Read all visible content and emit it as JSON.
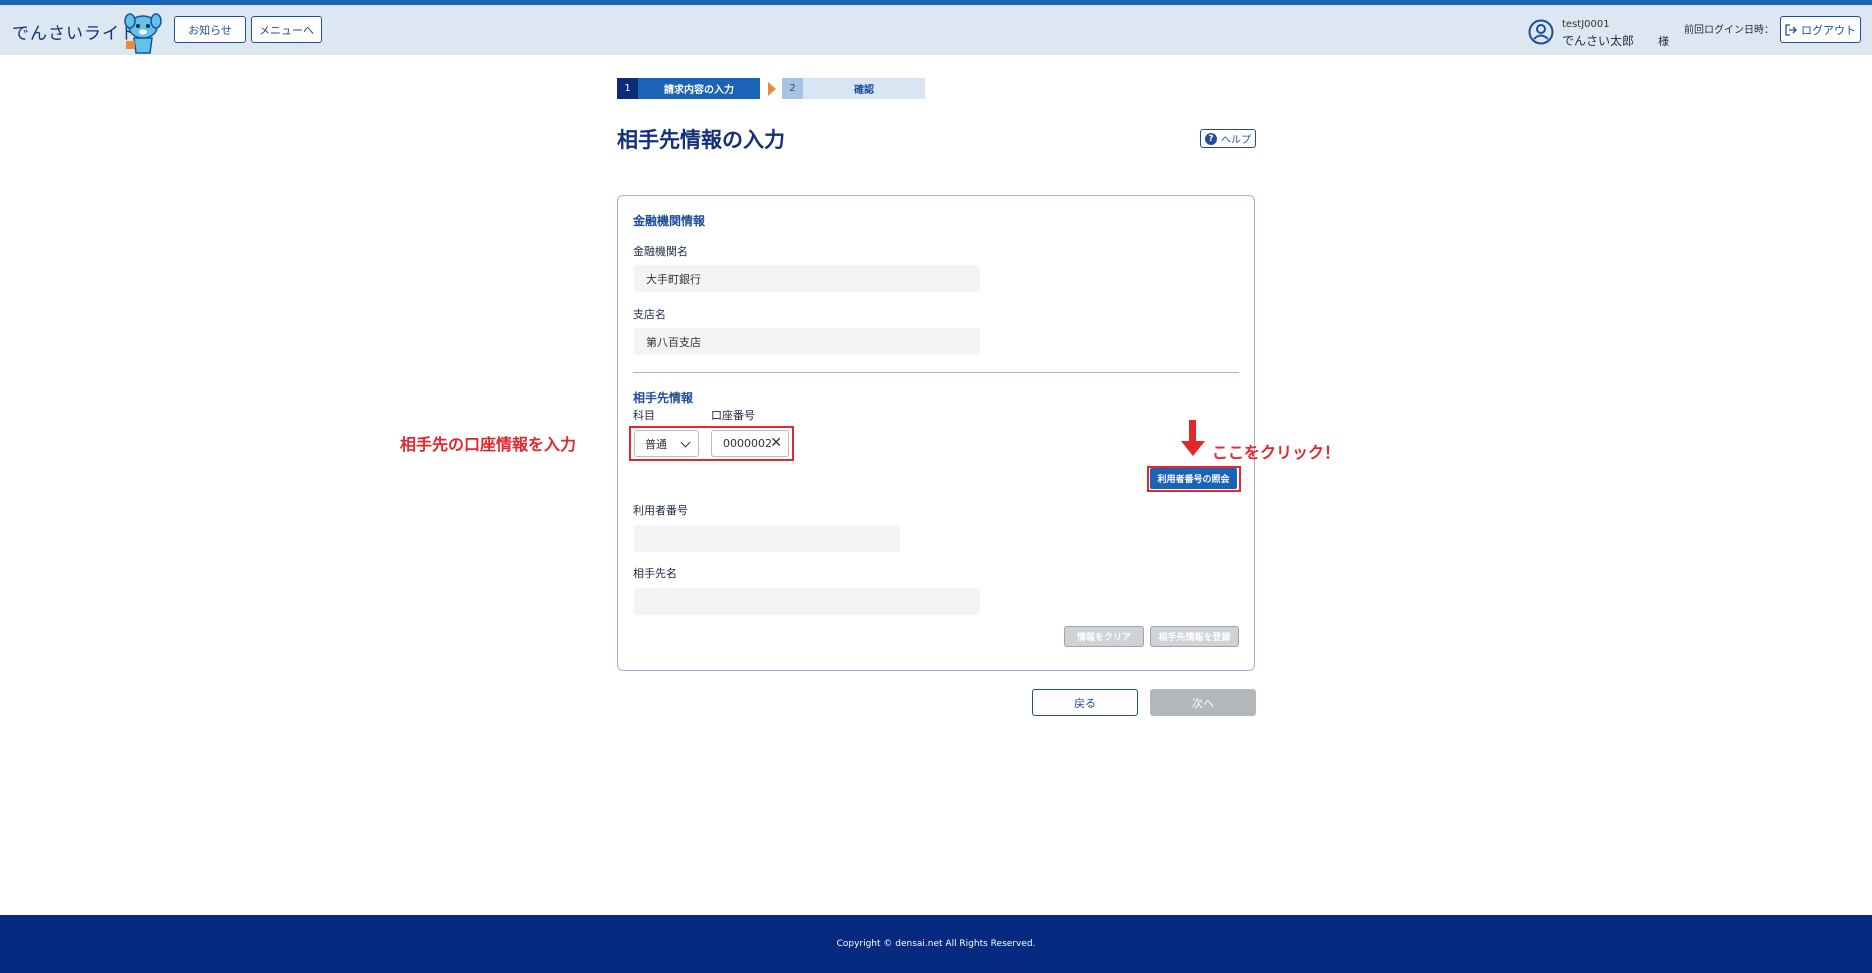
{
  "header": {
    "logo": "でんさいライト",
    "notice_button": "お知らせ",
    "menu_button": "メニューへ",
    "user_id": "testJ0001",
    "user_name": "でんさい太郎",
    "honorific": "様",
    "last_login_label": "前回ログイン日時：",
    "logout_button": "ログアウト",
    "icons": {
      "logout": "logout-icon",
      "user": "user-icon",
      "mascot": "mascot-logo"
    }
  },
  "stepper": {
    "steps": [
      {
        "number": "1",
        "label": "請求内容の入力"
      },
      {
        "number": "2",
        "label": "確認"
      }
    ]
  },
  "page": {
    "title": "相手先情報の入力",
    "help_label": "ヘルプ"
  },
  "bank_info": {
    "section_title": "金融機関情報",
    "bank_name_label": "金融機関名",
    "bank_name_value": "大手町銀行",
    "branch_label": "支店名",
    "branch_value": "第八百支店"
  },
  "partner_info": {
    "section_title": "相手先情報",
    "account_type_label": "科目",
    "account_type_value": "普通",
    "account_number_label": "口座番号",
    "account_number_value": "0000002",
    "lookup_button": "利用者番号の照会",
    "user_number_label": "利用者番号",
    "partner_name_label": "相手先名",
    "clear_button": "情報をクリア",
    "register_button": "相手先情報を登録"
  },
  "nav": {
    "back_button": "戻る",
    "next_button": "次へ"
  },
  "annotations": {
    "left_note": "相手先の口座情報を入力",
    "right_note": "ここをクリック！"
  },
  "footer": {
    "copyright": "Copyright © densai.net All Rights Reserved."
  },
  "colors": {
    "accent": "#1b63b6",
    "navy": "#062a80",
    "annotation": "#e5262b",
    "step_arrow": "#e88a3a"
  }
}
